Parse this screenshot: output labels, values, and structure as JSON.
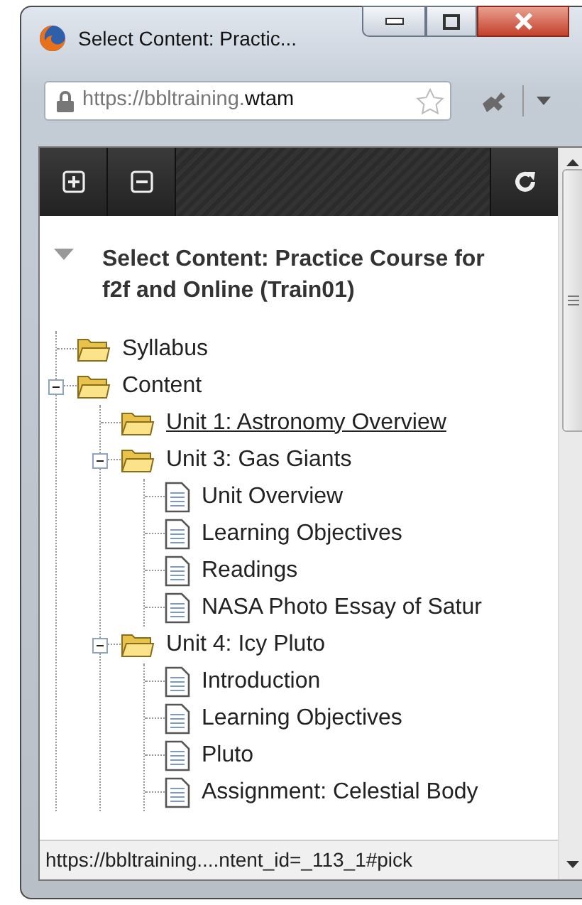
{
  "window": {
    "title": "Select Content: Practic..."
  },
  "address_bar": {
    "scheme_part": "https://bbltraining.",
    "domain_part": "wtam"
  },
  "heading": {
    "text": "Select Content: Practice Course for f2f and Online (Train01)",
    "expanded": true
  },
  "tree": [
    {
      "label": "Syllabus",
      "kind": "folder",
      "hovered": false
    },
    {
      "label": "Content",
      "kind": "folder",
      "hovered": false,
      "expanded": true,
      "children": [
        {
          "label": "Unit 1: Astronomy Overview",
          "kind": "folder",
          "hovered": true
        },
        {
          "label": "Unit 3: Gas Giants",
          "kind": "folder",
          "hovered": false,
          "expanded": true,
          "children": [
            {
              "label": "Unit Overview",
              "kind": "document",
              "hovered": false
            },
            {
              "label": "Learning Objectives",
              "kind": "document",
              "hovered": false
            },
            {
              "label": "Readings",
              "kind": "document",
              "hovered": false
            },
            {
              "label": "NASA Photo Essay of Satur",
              "kind": "document",
              "hovered": false
            }
          ]
        },
        {
          "label": "Unit 4: Icy Pluto",
          "kind": "folder",
          "hovered": false,
          "expanded": true,
          "children": [
            {
              "label": "Introduction",
              "kind": "document",
              "hovered": false
            },
            {
              "label": "Learning Objectives",
              "kind": "document",
              "hovered": false
            },
            {
              "label": "Pluto",
              "kind": "document",
              "hovered": false
            },
            {
              "label": "Assignment: Celestial Body",
              "kind": "document",
              "hovered": false
            }
          ]
        }
      ]
    }
  ],
  "status_bar": {
    "url": "https://bbltraining....ntent_id=_113_1#pick"
  }
}
